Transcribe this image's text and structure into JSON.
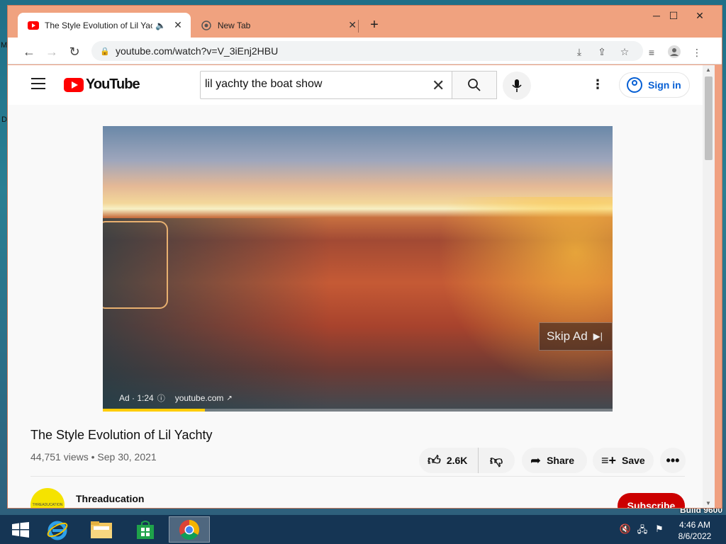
{
  "desktop": {
    "edge_label_m": "M",
    "edge_label_d": "D",
    "build_text": "Build 9600"
  },
  "browser": {
    "tabs": [
      {
        "title": "The Style Evolution of Lil Yachty",
        "active": true
      },
      {
        "title": "New Tab",
        "active": false
      }
    ],
    "url": "youtube.com/watch?v=V_3iEnj2HBU",
    "window_controls": {
      "minimize": "─",
      "maximize": "☐",
      "close": "✕"
    }
  },
  "youtube": {
    "logo_text": "YouTube",
    "search_value": "lil yachty the boat show",
    "signin_label": "Sign in",
    "ad": {
      "skip_label": "Skip Ad",
      "ad_time": "Ad · 1:24",
      "ad_domain": "youtube.com",
      "progress_fraction": 0.2
    },
    "video": {
      "title": "The Style Evolution of Lil Yachty",
      "meta": "44,751 views • Sep 30, 2021",
      "likes": "2.6K",
      "share_label": "Share",
      "save_label": "Save"
    },
    "channel": {
      "name": "Threaducation",
      "avatar_text": "THREADUCATION",
      "subscribe_label": "Subscribe"
    }
  },
  "taskbar": {
    "time": "4:46 AM",
    "date": "8/6/2022"
  },
  "colors": {
    "yt_red": "#ff0000",
    "subscribe_red": "#cc0000",
    "link_blue": "#065fd4",
    "window_frame": "#f0a27f"
  }
}
